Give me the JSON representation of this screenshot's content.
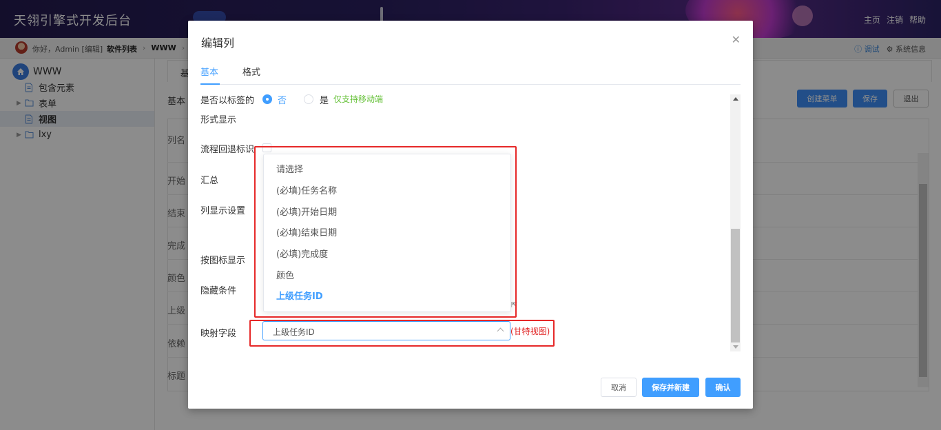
{
  "app": {
    "title": "天翎引擎式开发后台",
    "header_links": [
      "主页",
      "注销",
      "帮助"
    ]
  },
  "topbar": {
    "greeting": "你好，Admin [编辑]",
    "breadcrumbs": [
      "软件列表",
      "WWW"
    ],
    "debug_label": "调试",
    "sysinfo_label": "系统信息"
  },
  "sidebar": {
    "root": "WWW",
    "items": [
      {
        "label": "包含元素",
        "icon": "file-icon"
      },
      {
        "label": "表单",
        "icon": "folder-icon"
      },
      {
        "label": "视图",
        "icon": "file-icon"
      },
      {
        "label": "lxy",
        "icon": "folder-icon"
      }
    ]
  },
  "background": {
    "tab_first": "基",
    "basic_label": "基本",
    "buttons": {
      "create_menu": "创建菜单",
      "save": "保存",
      "exit": "退出"
    },
    "row_labels": [
      "列名",
      "开始",
      "结束",
      "完成",
      "颜色",
      "上级",
      "依赖",
      "标题"
    ]
  },
  "modal": {
    "title": "编辑列",
    "tabs": [
      "基本",
      "格式"
    ],
    "form": {
      "tag_label_line1": "是否以标签的",
      "tag_label_line2": "形式显示",
      "radio_no": "否",
      "radio_yes": "是",
      "mobile_only_note": "仅支持移动端",
      "flow_back_label": "流程回退标识",
      "sum_label": "汇总",
      "col_display_label": "列显示设置",
      "icon_display_label": "按图标显示",
      "hide_cond_label": "隐藏条件",
      "map_field_label": "映射字段",
      "map_field_value": "上级任务ID",
      "gantt_note": "(甘特视图)"
    },
    "dropdown_options": [
      "请选择",
      "(必填)任务名称",
      "(必填)开始日期",
      "(必填)结束日期",
      "(必填)完成度",
      "颜色",
      "上级任务ID"
    ],
    "selected_option": "上级任务ID",
    "buttons": {
      "cancel": "取消",
      "save_new": "保存并新建",
      "confirm": "确认"
    }
  },
  "colors": {
    "accent": "#409eff",
    "highlight_red": "#e62828",
    "mobile_note_green": "#67c23a"
  }
}
